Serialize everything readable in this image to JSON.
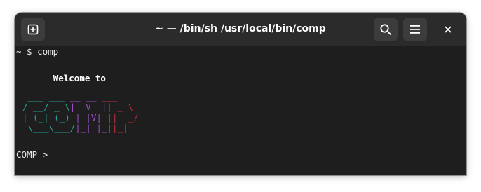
{
  "window": {
    "title": "~ — /bin/sh /usr/local/bin/comp"
  },
  "toolbar": {
    "new_tab_icon": "new-tab-icon",
    "search_icon": "search-icon",
    "menu_icon": "hamburger-menu-icon",
    "close_icon": "close-icon"
  },
  "terminal": {
    "command_line": "~ $ comp",
    "welcome": "Welcome to",
    "logo_text": "COMP",
    "logo_rows": [
      [
        " ___ ___ ",
        "__ __ ",
        "___ "
      ],
      [
        "/ __/ _ \\",
        "|  V  |",
        "| _ \\"
      ],
      [
        "| (_| (_) ",
        "| |V| |",
        "|  _/"
      ],
      [
        " \\___\\___/",
        "|_| |_|",
        "|_|  "
      ]
    ],
    "prompt": "COMP >",
    "cursor_visible": true
  },
  "colors": {
    "c_color": "#2aa198",
    "o_color": "#2aa198",
    "m_color": "#9b4fc4",
    "p_color": "#c0303a",
    "terminal_bg": "#1e1e1e",
    "titlebar_bg": "#2b2b2b"
  }
}
